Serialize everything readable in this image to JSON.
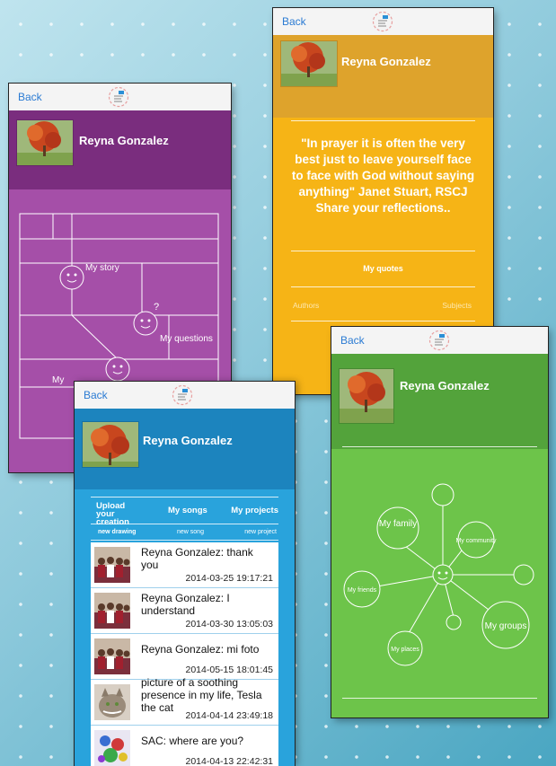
{
  "common": {
    "back_label": "Back",
    "profile_name": "Reyna Gonzalez"
  },
  "purple": {
    "map_labels": [
      "My story",
      "My questions",
      "My"
    ],
    "question_mark": "?"
  },
  "yellow": {
    "quote": "\"In prayer it is often the very best just to leave yourself face to face with God without saying anything\" Janet Stuart, RSCJ",
    "prompt": "Share your reflections..",
    "my_quotes": "My quotes",
    "authors": "Authors",
    "subjects": "Subjects"
  },
  "blue": {
    "tabs": [
      "Upload your creation",
      "My songs",
      "My projects"
    ],
    "subtabs": [
      "new drawing",
      "new song",
      "new project"
    ],
    "items": [
      {
        "text": "Reyna Gonzalez: thank you",
        "date": "2014-03-25 19:17:21"
      },
      {
        "text": "Reyna Gonzalez: I understand",
        "date": "2014-03-30 13:05:03"
      },
      {
        "text": "Reyna Gonzalez: mi foto",
        "date": "2014-05-15 18:01:45"
      },
      {
        "text": "picture of a soothing presence in my life, Tesla the cat",
        "date": "2014-04-14 23:49:18"
      },
      {
        "text": "SAC: where are you?",
        "date": "2014-04-13 22:42:31"
      }
    ]
  },
  "green": {
    "nodes": [
      "My family",
      "My community",
      "My friends",
      "My groups",
      "My places"
    ]
  },
  "colors": {
    "purple": "#a54fa8",
    "purple_dark": "#7a2d7e",
    "yellow": "#f6b416",
    "yellow_dark": "#dea32c",
    "blue": "#29a3dc",
    "blue_dark": "#1c84be",
    "green": "#6dc44a",
    "green_dark": "#53a33b",
    "link": "#2b7bd3"
  }
}
